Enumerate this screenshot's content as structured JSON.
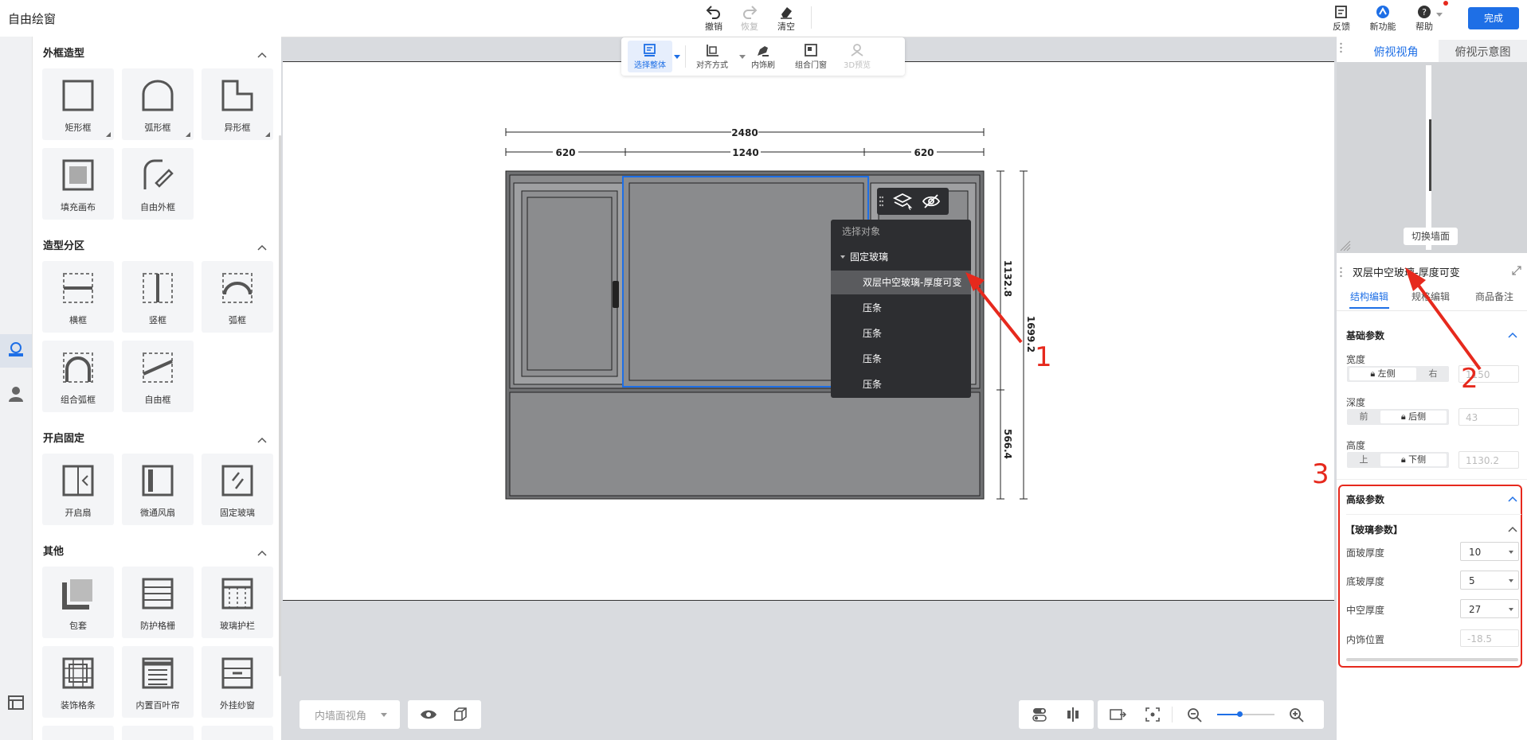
{
  "app": {
    "title": "自由绘窗"
  },
  "toolbar": {
    "undo": "撤销",
    "redo": "恢复",
    "clear": "清空",
    "feedback": "反馈",
    "new_feature": "新功能",
    "help": "帮助",
    "done": "完成"
  },
  "left_panel": {
    "sections": [
      {
        "title": "外框造型",
        "items": [
          "矩形框",
          "弧形框",
          "异形框",
          "填充画布",
          "自由外框"
        ]
      },
      {
        "title": "造型分区",
        "items": [
          "横框",
          "竖框",
          "弧框",
          "组合弧框",
          "自由框"
        ]
      },
      {
        "title": "开启固定",
        "items": [
          "开启扇",
          "微通风扇",
          "固定玻璃"
        ]
      },
      {
        "title": "其他",
        "items": [
          "包套",
          "防护格栅",
          "玻璃护栏",
          "装饰格条",
          "内置百叶帘",
          "外挂纱窗"
        ]
      }
    ]
  },
  "float_toolbar": {
    "select_all": "选择整体",
    "align": "对齐方式",
    "decor_brush": "内饰刷",
    "combine_door": "组合门窗",
    "preview_3d": "3D预览"
  },
  "drawing": {
    "dim_total": "2480",
    "dim_left": "620",
    "dim_mid": "1240",
    "dim_right": "620",
    "dim_v_upper": "1132.8",
    "dim_v_total": "1699.2",
    "dim_v_lower": "566.4"
  },
  "context_menu": {
    "header": "选择对象",
    "group": "固定玻璃",
    "items": [
      "双层中空玻璃-厚度可变",
      "压条",
      "压条",
      "压条",
      "压条"
    ]
  },
  "bottom_bar": {
    "view_select": "内墙面视角"
  },
  "right_panel": {
    "view_tabs": [
      "俯视视角",
      "俯视示意图"
    ],
    "switch_wall": "切换墙面",
    "object_title": "双层中空玻璃-厚度可变",
    "edit_tabs": [
      "结构编辑",
      "规格编辑",
      "商品备注"
    ],
    "basic_params": {
      "title": "基础参数",
      "width": {
        "label": "宽度",
        "opt_a": "左侧",
        "opt_b": "右",
        "value": "1150"
      },
      "depth": {
        "label": "深度",
        "opt_a": "前",
        "opt_b": "后侧",
        "value": "43"
      },
      "height": {
        "label": "高度",
        "opt_a": "上",
        "opt_b": "下侧",
        "value": "1130.2"
      }
    },
    "advanced_params": {
      "title": "高级参数",
      "group": "【玻璃参数】",
      "face_glass": {
        "label": "面玻厚度",
        "value": "10"
      },
      "base_glass": {
        "label": "底玻厚度",
        "value": "5"
      },
      "hollow": {
        "label": "中空厚度",
        "value": "27"
      },
      "decor_pos": {
        "label": "内饰位置",
        "value": "-18.5"
      }
    }
  },
  "annotations": {
    "a1": "1",
    "a2": "2",
    "a3": "3"
  }
}
